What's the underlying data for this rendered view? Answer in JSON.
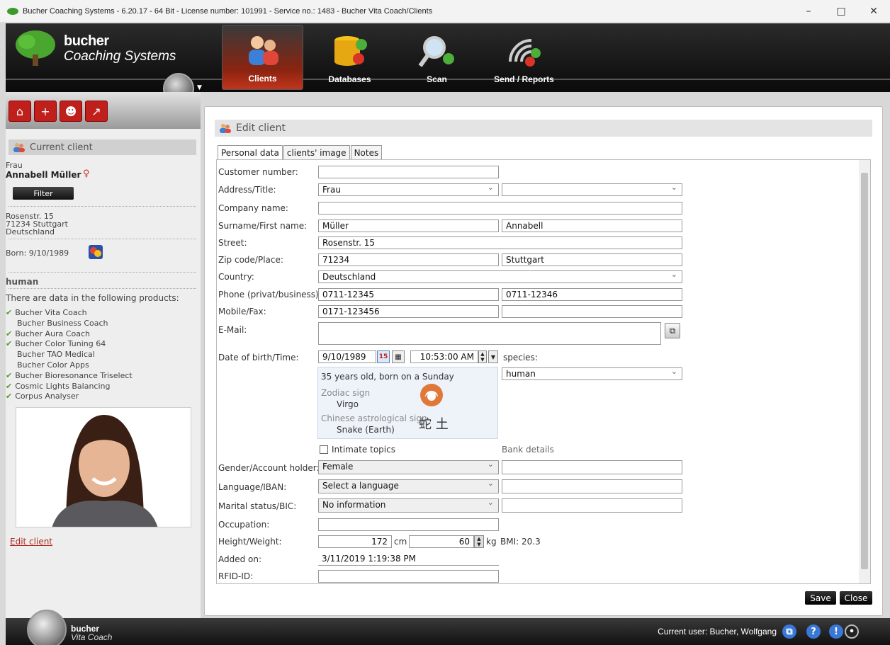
{
  "window": {
    "title": "Bucher Coaching Systems - 6.20.17 - 64 Bit - License number: 101991 - Service no.: 1483 - Bucher Vita Coach/Clients",
    "minimize": "–",
    "maximize": "□",
    "close": "✕"
  },
  "header": {
    "brand_line1": "bucher",
    "brand_line2": "Coaching Systems",
    "nav": [
      {
        "label": "Clients",
        "active": true
      },
      {
        "label": "Databases",
        "active": false
      },
      {
        "label": "Scan",
        "active": false
      },
      {
        "label": "Send / Reports",
        "active": false
      }
    ]
  },
  "sidebar": {
    "current_client_title": "Current client",
    "salutation": "Frau",
    "client_name": "Annabell Müller",
    "gender_symbol": "♀",
    "filter_label": "Filter",
    "address_line1": "Rosenstr. 15",
    "address_line2": "71234 Stuttgart",
    "address_line3": "Deutschland",
    "born": "Born: 9/10/1989",
    "species": "human",
    "products_intro": "There are data in the following products:",
    "products": [
      {
        "name": "Bucher Vita Coach",
        "checked": true
      },
      {
        "name": "Bucher Business Coach",
        "checked": false
      },
      {
        "name": "Bucher Aura Coach",
        "checked": true
      },
      {
        "name": "Bucher Color Tuning 64",
        "checked": true
      },
      {
        "name": "Bucher TAO Medical",
        "checked": false
      },
      {
        "name": "Bucher Color Apps",
        "checked": false
      },
      {
        "name": "Bucher Bioresonance Triselect",
        "checked": true
      },
      {
        "name": "Cosmic Lights Balancing",
        "checked": true
      },
      {
        "name": "Corpus Analyser",
        "checked": true
      }
    ],
    "edit_client_link": "Edit client"
  },
  "main": {
    "panel_title": "Edit client",
    "tabs": [
      "Personal data",
      "clients' image",
      "Notes"
    ],
    "labels": {
      "customer_number": "Customer number:",
      "address_title": "Address/Title:",
      "company": "Company name:",
      "surname_first": "Surname/First name:",
      "street": "Street:",
      "zip_place": "Zip code/Place:",
      "country": "Country:",
      "phone": "Phone (privat/business):",
      "mobile_fax": "Mobile/Fax:",
      "email": "E-Mail:",
      "dob_time": "Date of birth/Time:",
      "species": "species:",
      "intimate": "Intimate topics",
      "bank_details": "Bank details",
      "gender_holder": "Gender/Account holder:",
      "language_iban": "Language/IBAN:",
      "marital_bic": "Marital status/BIC:",
      "occupation": "Occupation:",
      "height_weight": "Height/Weight:",
      "added_on": "Added on:",
      "rfid": "RFID-ID:",
      "cm": "cm",
      "kg": "kg",
      "bmi": "BMI:  20.3"
    },
    "values": {
      "customer_number": "",
      "address": "Frau",
      "title": "",
      "company": "",
      "surname": "Müller",
      "first_name": "Annabell",
      "street": "Rosenstr. 15",
      "zip": "71234",
      "place": "Stuttgart",
      "country": "Deutschland",
      "phone_private": "0711-12345",
      "phone_business": "0711-12346",
      "mobile": "0171-123456",
      "fax": "",
      "email": "",
      "dob": "9/10/1989",
      "time": "10:53:00 AM",
      "species": "human",
      "gender": "Female",
      "account_holder": "",
      "language": "Select a language",
      "iban": "",
      "marital": "No information",
      "bic": "",
      "occupation": "",
      "height": "172",
      "weight": "60",
      "added_on": "3/11/2019 1:19:38 PM",
      "rfid": ""
    },
    "info": {
      "age_line": "35 years old, born on a Sunday",
      "zodiac_label": "Zodiac sign",
      "zodiac_value": "Virgo",
      "chinese_label": "Chinese astrological sign",
      "chinese_value": "Snake (Earth)",
      "chinese_glyphs": "蛇 土"
    },
    "calendar_day": "15",
    "save": "Save",
    "close": "Close"
  },
  "footer": {
    "brand_line1": "bucher",
    "brand_line2": "Vita Coach",
    "current_user": "Current user: Bucher, Wolfgang"
  }
}
